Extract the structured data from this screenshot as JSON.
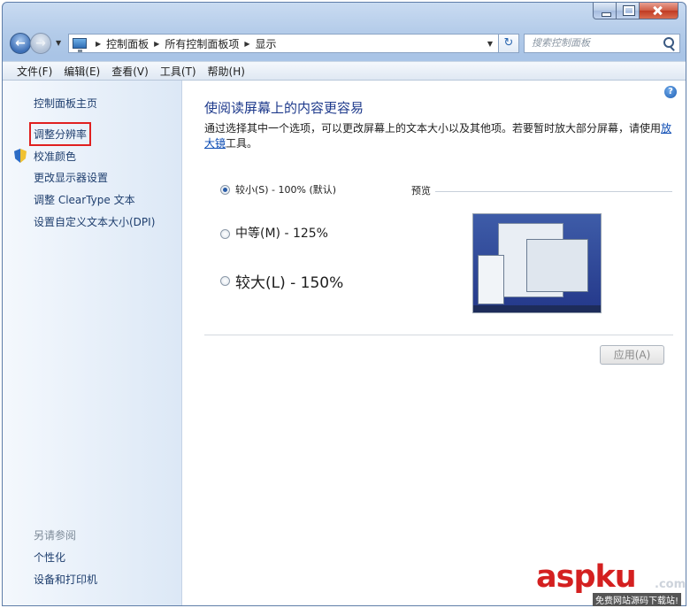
{
  "window": {
    "caption_icons": [
      "minimize-icon",
      "maximize-icon",
      "close-icon"
    ]
  },
  "address_bar": {
    "breadcrumbs": [
      "控制面板",
      "所有控制面板项",
      "显示"
    ],
    "search_placeholder": "搜索控制面板"
  },
  "menu": [
    "文件(F)",
    "编辑(E)",
    "查看(V)",
    "工具(T)",
    "帮助(H)"
  ],
  "sidebar": {
    "links": [
      "控制面板主页",
      "调整分辨率",
      "校准颜色",
      "更改显示器设置",
      "调整 ClearType 文本",
      "设置自定义文本大小(DPI)"
    ],
    "see_also_title": "另请参阅",
    "see_also_links": [
      "个性化",
      "设备和打印机"
    ]
  },
  "main": {
    "title": "使阅读屏幕上的内容更容易",
    "description_prefix": "通过选择其中一个选项，可以更改屏幕上的文本大小以及其他项。若要暂时放大部分屏幕，请使用",
    "description_link": "放大镜",
    "description_suffix": "工具。",
    "options": [
      {
        "label": "较小(S) - 100% (默认)",
        "checked": true
      },
      {
        "label": "中等(M) - 125%",
        "checked": false
      },
      {
        "label": "较大(L) - 150%",
        "checked": false
      }
    ],
    "preview_label": "预览",
    "apply_label": "应用(A)"
  },
  "watermark": {
    "brand": "aspku",
    "tld": ".com",
    "tagline": "免费网站源码下载站!"
  },
  "colors": {
    "link": "#1e3e6e",
    "heading": "#1e3a8c",
    "highlight_box": "#e02020",
    "watermark": "#d42020"
  }
}
